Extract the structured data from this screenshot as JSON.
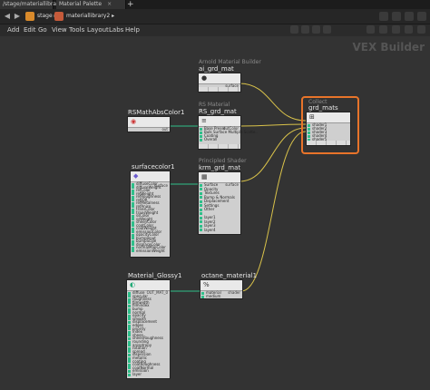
{
  "tabs": [
    {
      "label": "/stage/materiallibrary2"
    },
    {
      "label": "Material Palette"
    }
  ],
  "tab_add": "+",
  "path": [
    {
      "label": "stage"
    },
    {
      "label": "materiallibrary2"
    }
  ],
  "menu": [
    "Add",
    "Edit",
    "Go",
    "View",
    "Tools",
    "Layout",
    "Labs",
    "Help"
  ],
  "context_label": "VEX Builder",
  "nodes": {
    "arnold": {
      "type": "Arnold Material Builder",
      "name": "ai_grd_mat",
      "output": "surface"
    },
    "rs": {
      "type": "RS Material",
      "name": "RS_grd_mat",
      "ports": [
        "Base Preset",
        "Bulk Surface Multiple Scatte..",
        "Coating",
        "Overall"
      ],
      "output": "outColor"
    },
    "collect": {
      "type": "Collect",
      "name": "grd_mats",
      "ports": [
        "shader1",
        "shader2",
        "shader3",
        "shader4",
        "shader5"
      ]
    },
    "rsabs": {
      "name": "RSMathAbsColor1",
      "output": "out"
    },
    "surf": {
      "name": "surfacecolor1",
      "ports": [
        "diffuseColor",
        "diffuseWeight",
        "refColor",
        "refWeight",
        "refRoughness",
        "refIOR",
        "refMetalness",
        "refAniso",
        "transColor",
        "transWeight",
        "ssColor",
        "ssWeight",
        "sheenColor",
        "coatColor",
        "coatWeight",
        "emissionColor",
        "opacityColor",
        "bumpInput",
        "bumpScale",
        "displaceColor",
        "normalMapColor",
        "emissionWeight"
      ],
      "output": "surface"
    },
    "krm": {
      "type": "Principled Shader",
      "name": "krm_grd_mat",
      "ports": [
        "Surface",
        "Opacity",
        "Textures",
        "Bump & Normals",
        "Displacement",
        "Settings",
        "Other",
        "",
        "layer1",
        "layer2",
        "layer3",
        "layer4"
      ],
      "output": "surface"
    },
    "glossy": {
      "name": "Material_Glossy1",
      "ports": [
        "diffuse",
        "specular",
        "roughness",
        "filmwidth",
        "filmindex",
        "bump",
        "normal",
        "opacity",
        "smooth",
        "displacement",
        "edges",
        "priority",
        "index",
        "sheen",
        "sheenRoughness",
        "rounding",
        "anisotropy",
        "rotation",
        "spread",
        "dispersion",
        "metallic",
        "coating",
        "coatRoughness",
        "coatNormal",
        "emission",
        "layer"
      ],
      "output": "OUT_MAT_0"
    },
    "octane": {
      "name": "octane_material1",
      "ports": [
        "material",
        "medium"
      ],
      "output": "shader"
    }
  }
}
